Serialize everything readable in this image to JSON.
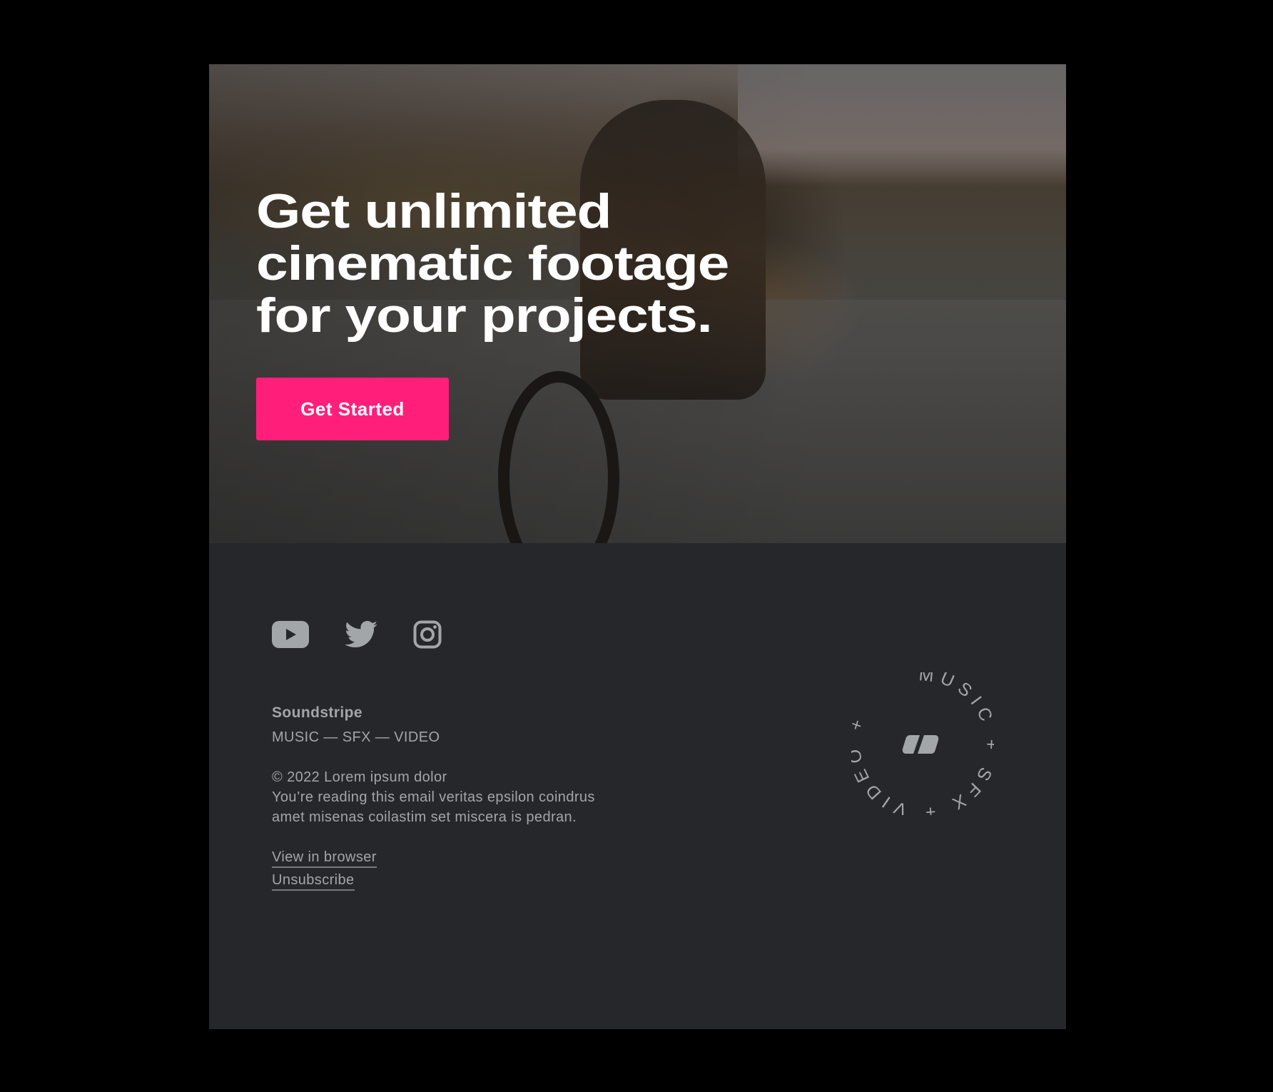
{
  "hero": {
    "headline_lines": [
      "Get unlimited",
      "cinematic footage",
      "for your projects."
    ],
    "cta_label": "Get Started",
    "cta_color": "#ff1f7a"
  },
  "footer": {
    "social": [
      {
        "name": "youtube",
        "icon": "youtube-icon"
      },
      {
        "name": "twitter",
        "icon": "twitter-icon"
      },
      {
        "name": "instagram",
        "icon": "instagram-icon"
      }
    ],
    "brand": "Soundstripe",
    "tagline": "MUSIC — SFX — VIDEO",
    "copyright": "© 2022 Lorem ipsum dolor",
    "body_lines": [
      "You’re reading this email veritas epsilon coindrus",
      "amet misenas coilastim set miscera is pedran."
    ],
    "links": {
      "view_in_browser": "View in browser",
      "unsubscribe": "Unsubscribe"
    },
    "badge_text": "MUSIC + SFX + VIDEO + ",
    "text_color": "#a2a6a8",
    "background": "#26272b"
  }
}
